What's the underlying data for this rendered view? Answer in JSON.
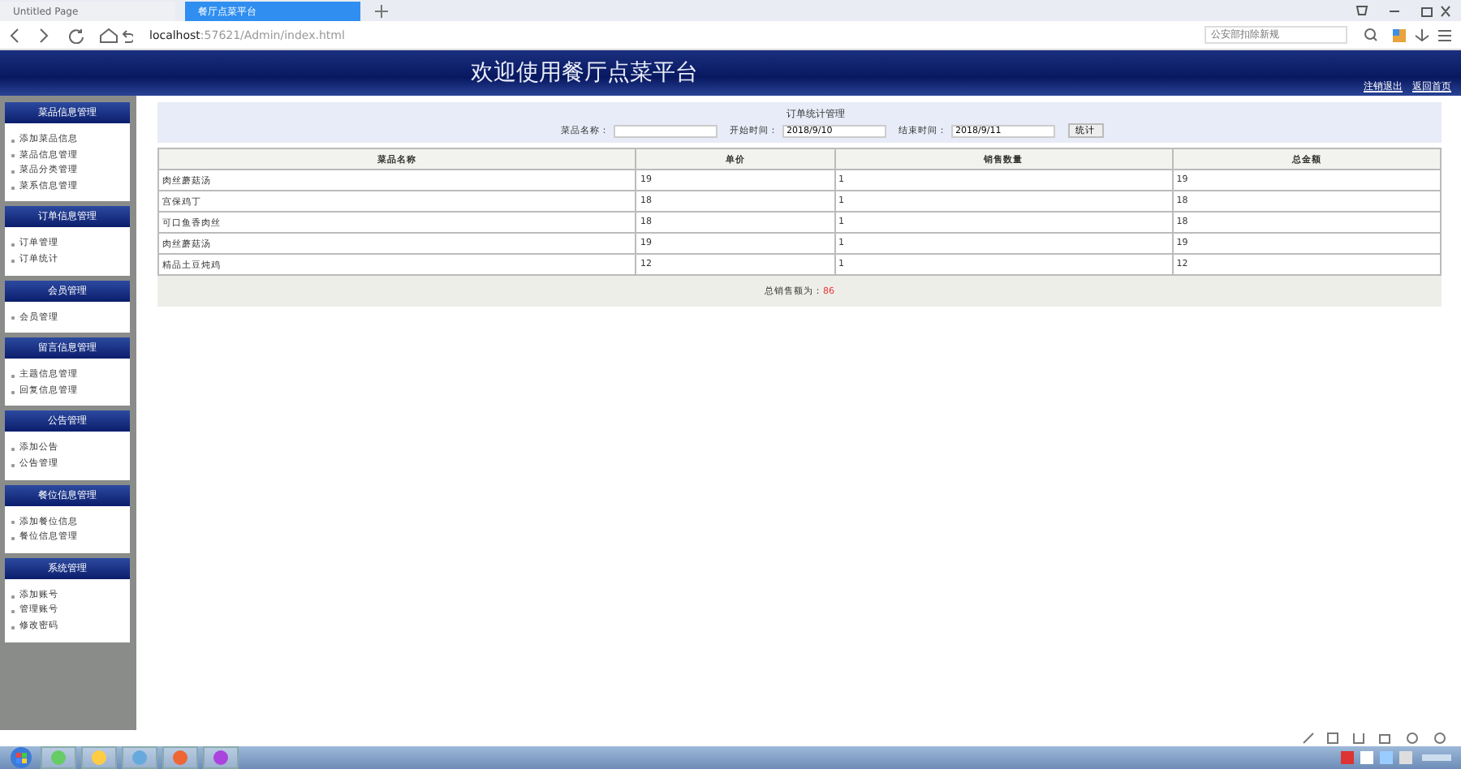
{
  "browser": {
    "tabs": [
      {
        "label": "Untitled Page",
        "selected": false
      },
      {
        "label": "餐厅点菜平台",
        "selected": true
      }
    ],
    "address": {
      "host": "localhost",
      "path": ":57621/Admin/index.html"
    },
    "search": {
      "placeholder": "公安部扣除新规"
    }
  },
  "banner": {
    "title": "欢迎使用餐厅点菜平台",
    "links": [
      "注销退出",
      "返回首页"
    ]
  },
  "sidebar": {
    "groups": [
      {
        "title": "菜品信息管理",
        "items": [
          "添加菜品信息",
          "菜品信息管理",
          "菜品分类管理",
          "菜系信息管理"
        ]
      },
      {
        "title": "订单信息管理",
        "items": [
          "订单管理",
          "订单统计"
        ]
      },
      {
        "title": "会员管理",
        "items": [
          "会员管理"
        ]
      },
      {
        "title": "留言信息管理",
        "items": [
          "主题信息管理",
          "回复信息管理"
        ]
      },
      {
        "title": "公告管理",
        "items": [
          "添加公告",
          "公告管理"
        ]
      },
      {
        "title": "餐位信息管理",
        "items": [
          "添加餐位信息",
          "餐位信息管理"
        ]
      },
      {
        "title": "系统管理",
        "items": [
          "添加账号",
          "管理账号",
          "修改密码"
        ]
      }
    ]
  },
  "panel": {
    "title": "订单统计管理",
    "filters": [
      {
        "label": "菜品名称："
      },
      {
        "label": "开始时间：",
        "value": "2018/9/10"
      },
      {
        "label": "结束时间：",
        "value": "2018/9/11"
      }
    ],
    "button": "统计"
  },
  "table": {
    "columns": [
      "菜品名称",
      "单价",
      "销售数量",
      "总金额"
    ],
    "rows": [
      [
        "肉丝蘑菇汤",
        "19",
        "1",
        "19"
      ],
      [
        "宫保鸡丁",
        "18",
        "1",
        "18"
      ],
      [
        "可口鱼香肉丝",
        "18",
        "1",
        "18"
      ],
      [
        "肉丝蘑菇汤",
        "19",
        "1",
        "19"
      ],
      [
        "精品土豆炖鸡",
        "12",
        "1",
        "12"
      ]
    ]
  },
  "total": {
    "label": "总销售额为：",
    "value": "86"
  }
}
